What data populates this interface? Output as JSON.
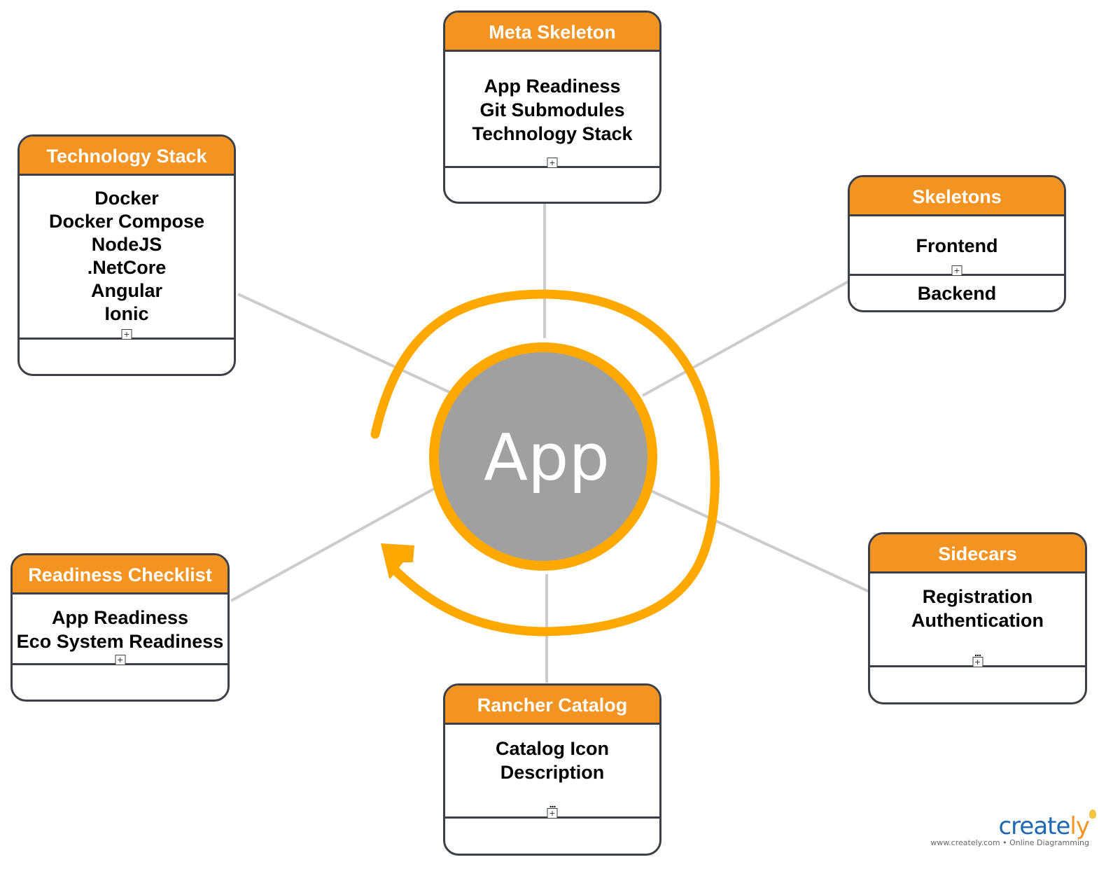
{
  "center": {
    "label": "App"
  },
  "colors": {
    "accent": "#f39322",
    "ring": "#ffa800",
    "center_fill": "#a0a0a0",
    "connector": "#cccccc",
    "border": "#3c3f45"
  },
  "cards": {
    "meta_skeleton": {
      "title": "Meta Skeleton",
      "items": [
        "App Readiness",
        "Git Submodules",
        "Technology Stack"
      ],
      "footer": ""
    },
    "technology_stack": {
      "title": "Technology Stack",
      "items": [
        "Docker",
        "Docker Compose",
        "NodeJS",
        ".NetCore",
        "Angular",
        "Ionic"
      ],
      "footer": ""
    },
    "skeletons": {
      "title": "Skeletons",
      "items": [
        "Frontend"
      ],
      "footer": "Backend"
    },
    "readiness_checklist": {
      "title": "Readiness Checklist",
      "items": [
        "App Readiness",
        "Eco System Readiness"
      ],
      "footer": ""
    },
    "sidecars": {
      "title": "Sidecars",
      "items": [
        "Registration",
        "Authentication"
      ],
      "footer": "",
      "more": "..."
    },
    "rancher_catalog": {
      "title": "Rancher Catalog",
      "items": [
        "Catalog Icon",
        "Description"
      ],
      "footer": "",
      "more": "..."
    }
  },
  "expand_glyph": "+",
  "branding": {
    "name_main": "creat",
    "name_e": "e",
    "name_y": "ly",
    "tagline": "www.creately.com • Online Diagramming"
  }
}
